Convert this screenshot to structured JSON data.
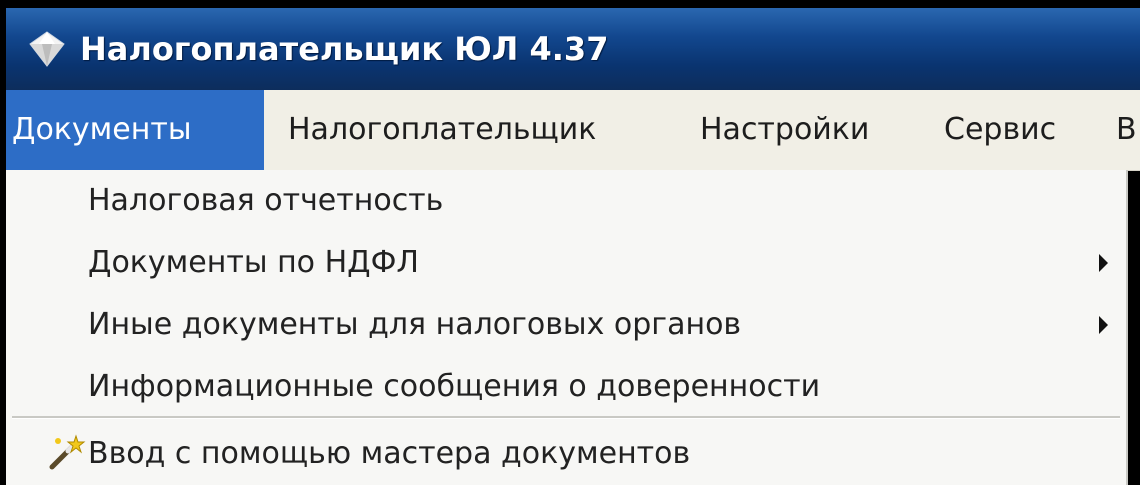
{
  "window": {
    "title": "Налогоплательщик ЮЛ 4.37",
    "icon": "app-diamond-icon"
  },
  "menubar": {
    "items": [
      {
        "label": "Документы",
        "active": true
      },
      {
        "label": "Налогоплательщик",
        "active": false
      },
      {
        "label": "Настройки",
        "active": false
      },
      {
        "label": "Сервис",
        "active": false
      },
      {
        "label": "В",
        "active": false
      }
    ]
  },
  "dropdown": {
    "items": [
      {
        "label": "Налоговая отчетность",
        "submenu": false
      },
      {
        "label": "Документы по НДФЛ",
        "submenu": true
      },
      {
        "label": "Иные документы для налоговых органов",
        "submenu": true
      },
      {
        "label": "Информационные сообщения о доверенности",
        "submenu": false
      },
      {
        "label": "Ввод с помощью мастера документов",
        "submenu": false,
        "icon": "wizard-wand-icon"
      }
    ]
  },
  "colors": {
    "titlebar": "#12478e",
    "menu_active": "#2d6dc6",
    "menubar_bg": "#f1efe6",
    "dropdown_bg": "#f7f7f5"
  }
}
